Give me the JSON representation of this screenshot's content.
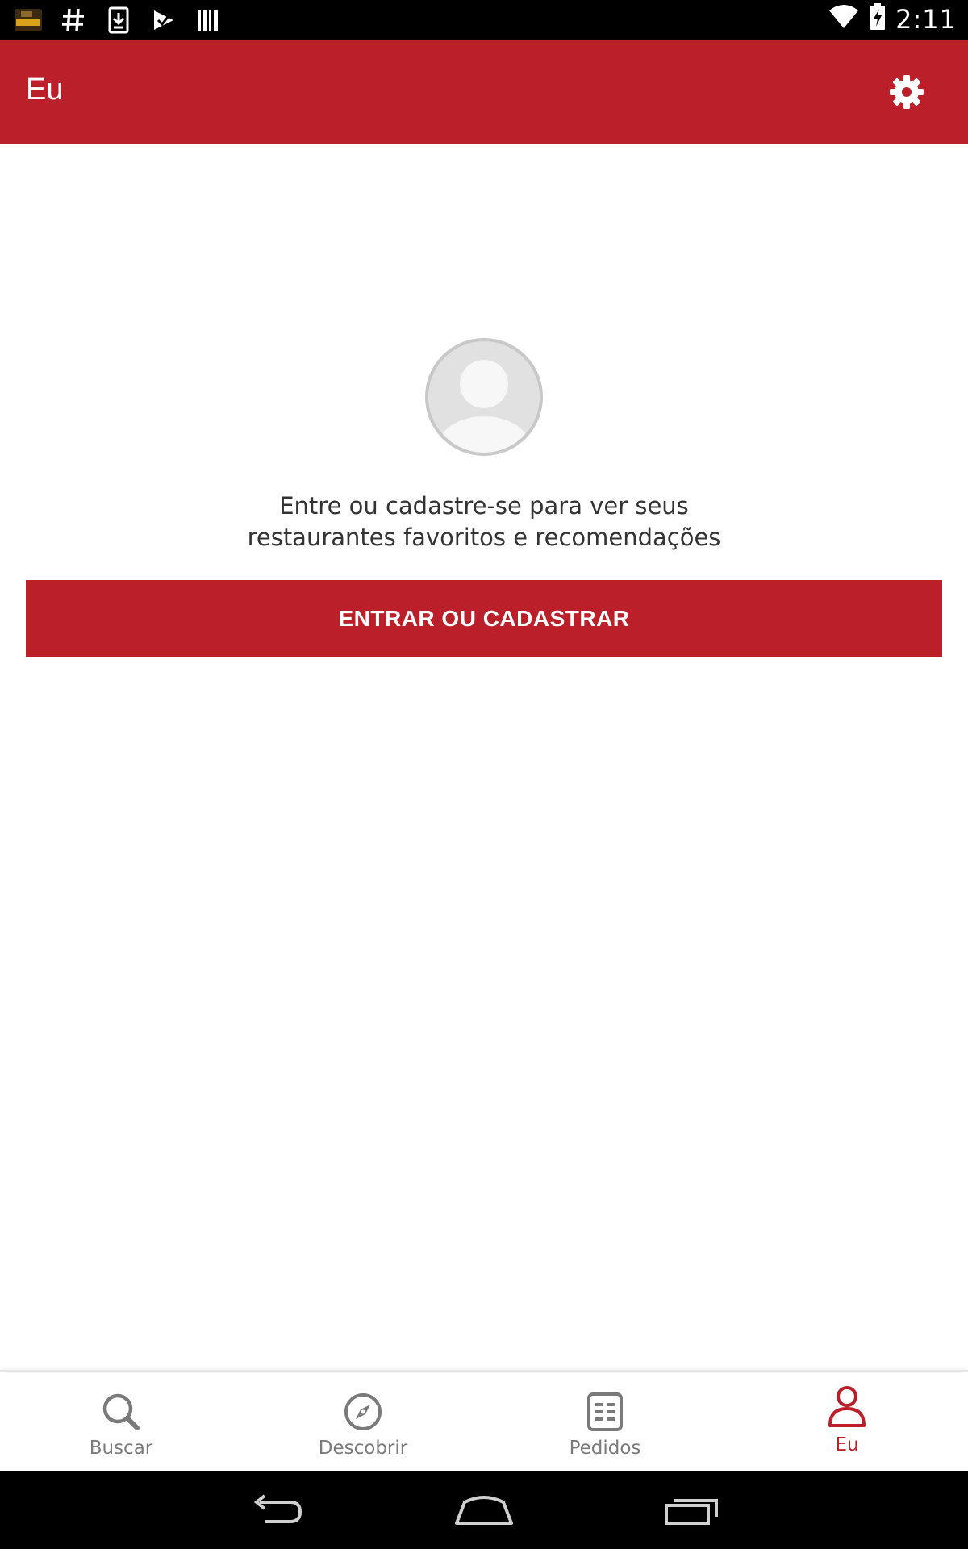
{
  "status_bar": {
    "time": "2:11",
    "notification_icons": [
      "recipes-app-icon",
      "hash-icon",
      "download-icon",
      "play-store-icon",
      "barcode-icon"
    ],
    "system_icons": [
      "wifi-icon",
      "battery-charging-icon"
    ]
  },
  "app_bar": {
    "title": "Eu",
    "settings_icon": "gear-icon",
    "background_color": "#bb1f2a"
  },
  "profile": {
    "avatar_icon": "default-avatar-icon",
    "prompt_line1": "Entre ou cadastre-se para ver seus",
    "prompt_line2": "restaurantes favoritos e recomendações",
    "login_button_label": "ENTRAR OU CADASTRAR"
  },
  "bottom_nav": {
    "items": [
      {
        "label": "Buscar",
        "icon": "search-icon",
        "active": false
      },
      {
        "label": "Descobrir",
        "icon": "compass-icon",
        "active": false
      },
      {
        "label": "Pedidos",
        "icon": "orders-icon",
        "active": false
      },
      {
        "label": "Eu",
        "icon": "user-icon",
        "active": true
      }
    ],
    "active_color": "#bb1f2a",
    "inactive_color": "#7a7a7a"
  },
  "system_nav": {
    "buttons": [
      "back-icon",
      "home-icon",
      "recents-icon"
    ]
  }
}
